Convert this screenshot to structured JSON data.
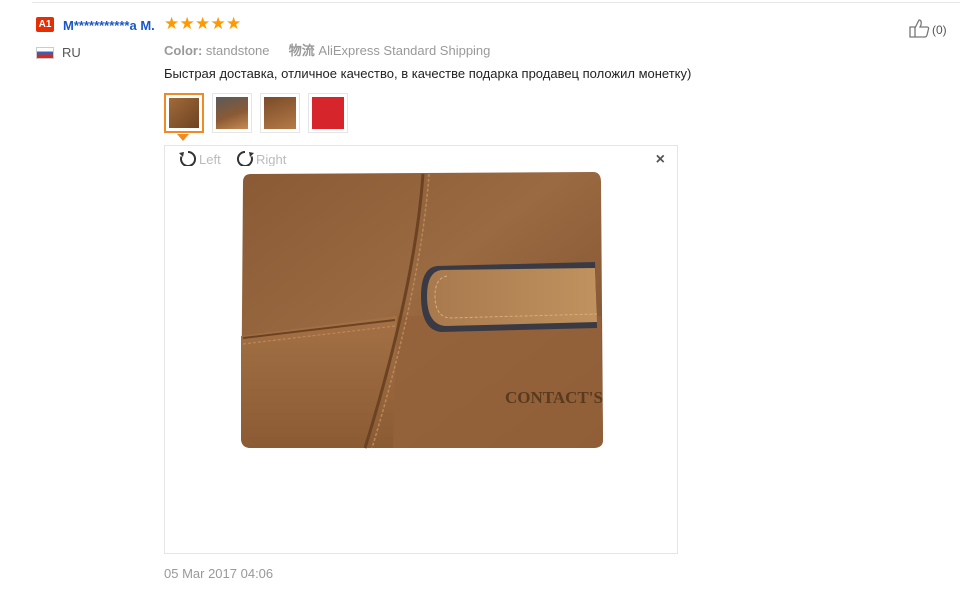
{
  "buyer": {
    "level": "A1",
    "name": "M***********a M.",
    "country": "RU"
  },
  "rating": {
    "stars": 5
  },
  "attributes": {
    "color_label": "Color:",
    "color_value": "standstone",
    "shipping_label": "物流",
    "shipping_value": "AliExpress Standard Shipping"
  },
  "review": {
    "text": "Быстрая доставка, отличное качество, в качестве подарка продавец положил монетку)"
  },
  "viewer": {
    "rotate_left": "Left",
    "rotate_right": "Right",
    "close": "×",
    "image_text": "CONTACT'S"
  },
  "date": "05 Mar 2017 04:06",
  "helpful": {
    "count": "(0)"
  },
  "icons": {
    "like": "thumbs-up-icon",
    "rotate_left": "rotate-left-icon",
    "rotate_right": "rotate-right-icon",
    "close": "close-icon",
    "star": "star-icon",
    "flag": "flag-icon"
  },
  "colors": {
    "badge": "#e62e04",
    "buyer_name": "#1a57c6",
    "star": "#ff9900",
    "active_thumb": "#f08a24"
  }
}
